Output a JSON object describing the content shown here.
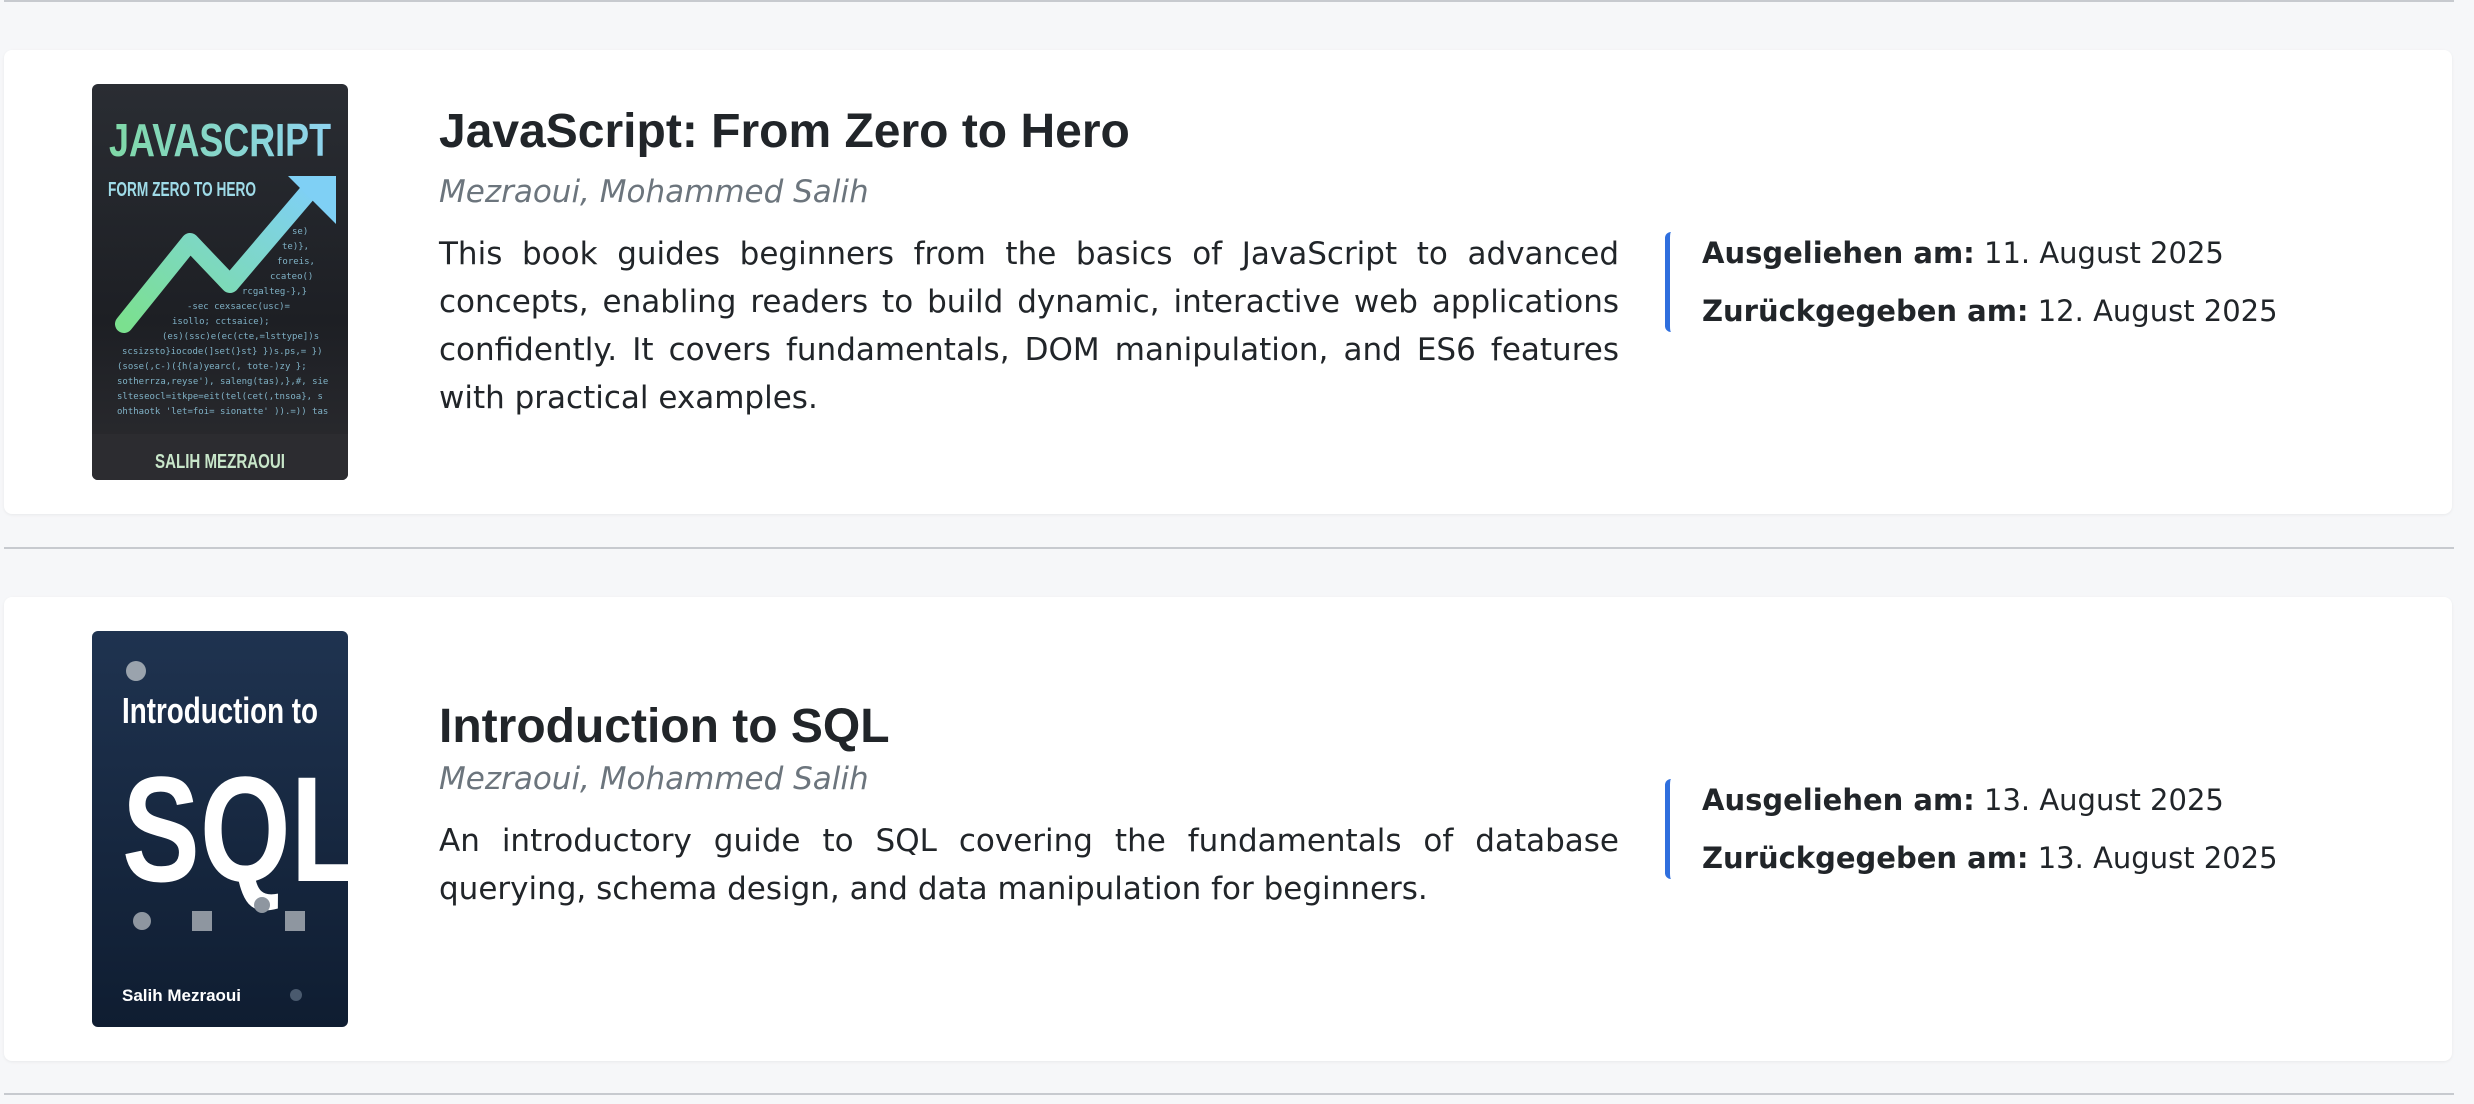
{
  "books": [
    {
      "title": "JavaScript: From Zero to Hero",
      "author": "Mezraoui, Mohammed Salih",
      "description": "This book guides beginners from the basics of JavaScript to advanced concepts, enabling readers to build dynamic, interactive web applications confidently. It covers fundamentals, DOM manipulation, and ES6 features with practical examples.",
      "borrowed_label": "Ausgeliehen am:",
      "borrowed_date": "11. August 2025",
      "returned_label": "Zurückgegeben am:",
      "returned_date": "12. August 2025",
      "cover": {
        "title_line1": "JAVASCRIPT",
        "title_line2": "FORM ZERO TO HERO",
        "author": "SALIH MEZRAOUI"
      }
    },
    {
      "title": "Introduction to SQL",
      "author": "Mezraoui, Mohammed Salih",
      "description": "An introductory guide to SQL covering the fundamentals of database querying, schema design, and data manipulation for beginners.",
      "borrowed_label": "Ausgeliehen am:",
      "borrowed_date": "13. August 2025",
      "returned_label": "Zurückgegeben am:",
      "returned_date": "13. August 2025",
      "cover": {
        "title_line1": "Introduction to",
        "title_line2": "SQL",
        "author": "Salih Mezraoui"
      }
    }
  ],
  "colors": {
    "accent": "#2f6fde",
    "muted_text": "#6c757d",
    "page_background": "#f6f7f9"
  }
}
